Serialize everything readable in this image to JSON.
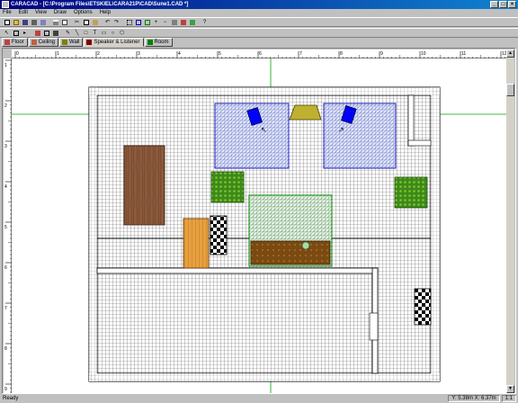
{
  "window": {
    "title": "CARACAD - [C:\\Program Files\\ETSKIEL\\CARA21P\\CAD\\Sune1.CAD *]",
    "controls": [
      "_",
      "□",
      "×"
    ]
  },
  "menu": [
    "File",
    "Edit",
    "View",
    "Draw",
    "Options",
    "Help"
  ],
  "tabs": [
    {
      "label": "Floor",
      "icon": "floor-icon",
      "color": "#c04040"
    },
    {
      "label": "Ceiling",
      "icon": "ceiling-icon",
      "color": "#c04040"
    },
    {
      "label": "Wall",
      "icon": "wall-icon",
      "color": "#808000"
    },
    {
      "label": "Speaker & Listener",
      "icon": "speaker-listener-icon",
      "color": "#800000",
      "active": true
    },
    {
      "label": "Room",
      "icon": "room-icon",
      "color": "#008000"
    }
  ],
  "rulers": {
    "horizontal": [
      "0",
      "1",
      "2",
      "3",
      "4",
      "5",
      "6",
      "7",
      "8",
      "9",
      "10",
      "11",
      "12"
    ],
    "vertical": [
      "1",
      "2",
      "3",
      "4",
      "5",
      "6",
      "7",
      "8",
      "9"
    ]
  },
  "status": {
    "text": "Ready",
    "coords": "Y: 5.38m X: 6.37m",
    "zoom": "1:1"
  },
  "colors": {
    "speaker": "#0000ff",
    "listening_area": "#0000a0",
    "sofa_area": "#008000",
    "table": "#8b5a3c",
    "chair": "#3a8a1a",
    "shelf": "#e8a040"
  }
}
